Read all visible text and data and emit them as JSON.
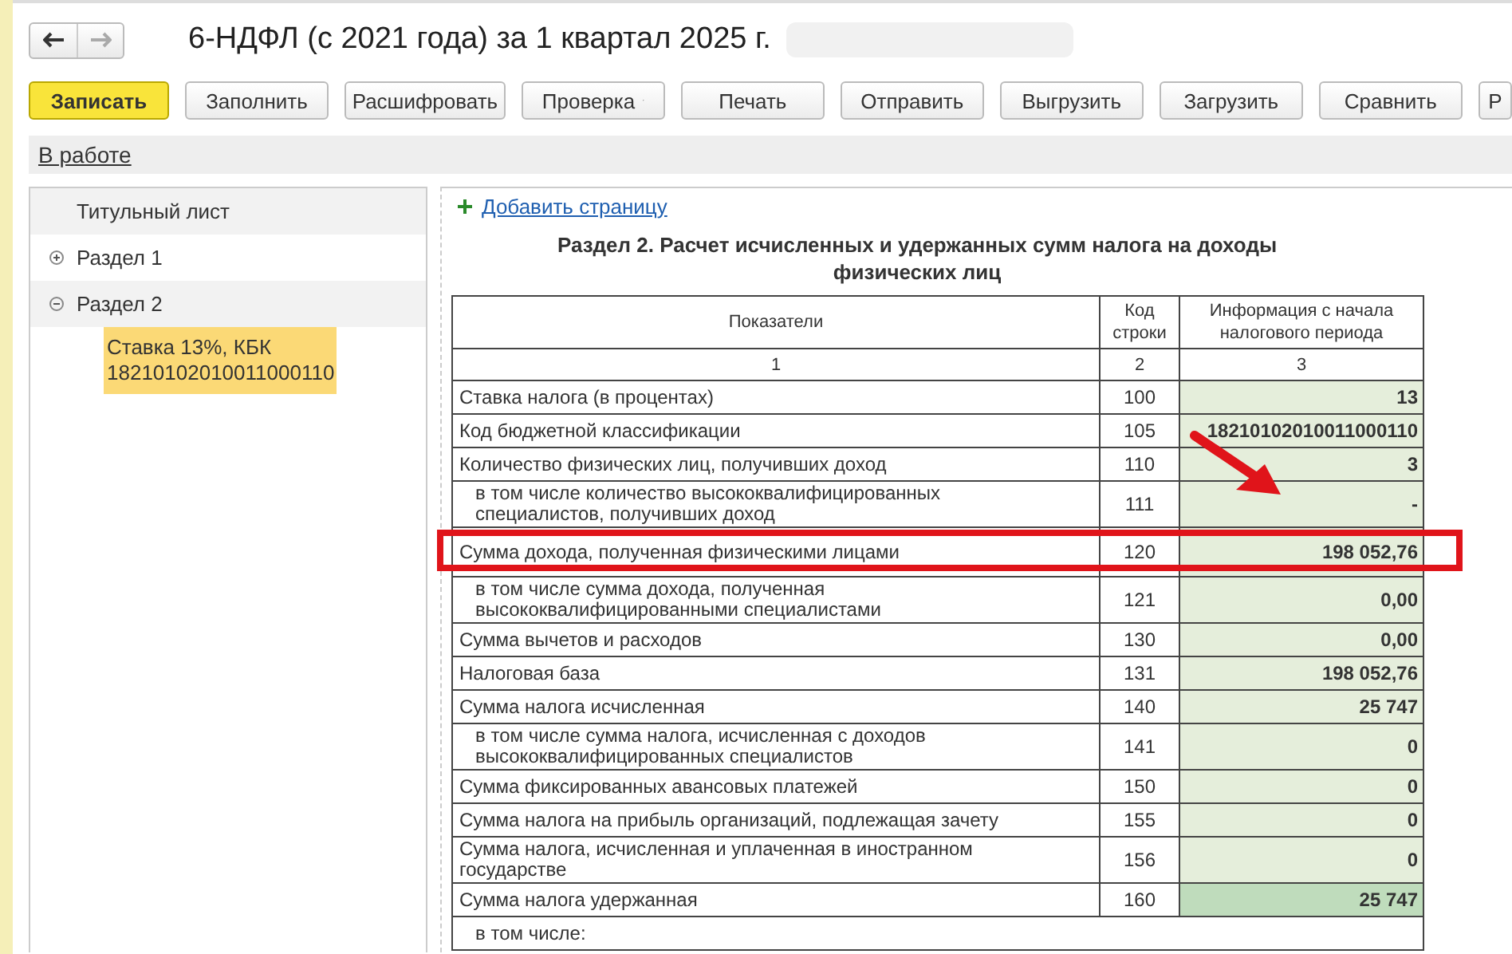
{
  "window": {
    "title": "6-НДФЛ (с 2021 года) за 1 квартал 2025 г."
  },
  "nav": [
    {
      "kind": "back",
      "disabled": false
    },
    {
      "kind": "forward",
      "disabled": true
    }
  ],
  "toolbar": [
    {
      "label": "Записать",
      "kind": "primary"
    },
    {
      "label": "Заполнить",
      "kind": "plain"
    },
    {
      "label": "Расшифровать",
      "kind": "plain"
    },
    {
      "label": "Проверка",
      "kind": "dropdown"
    },
    {
      "label": "Печать",
      "kind": "plain"
    },
    {
      "label": "Отправить",
      "kind": "plain"
    },
    {
      "label": "Выгрузить",
      "kind": "plain"
    },
    {
      "label": "Загрузить",
      "kind": "plain"
    },
    {
      "label": "Сравнить",
      "kind": "plain"
    },
    {
      "label": "Р",
      "kind": "plain"
    }
  ],
  "status_link": "В работе",
  "sidebar": {
    "items": [
      {
        "kind": "page",
        "label": "Титульный лист",
        "selected": false
      },
      {
        "kind": "section",
        "label": "Раздел 1",
        "expanded": false,
        "selected": false
      },
      {
        "kind": "section",
        "label": "Раздел 2",
        "expanded": true,
        "selected": false,
        "children": [
          {
            "label": "Ставка 13%, КБК 18210102010011000110",
            "selected": true
          }
        ]
      }
    ]
  },
  "add_page_link": "Добавить страницу",
  "section_title": "Раздел 2. Расчет исчисленных и удержанных сумм налога на доходы физических лиц",
  "table": {
    "columns": [
      "Показатели",
      "Код строки",
      "Информация с начала налогового периода"
    ],
    "column_numbers": [
      "1",
      "2",
      "3"
    ],
    "rows": [
      {
        "kind": "data",
        "label": "Ставка налога (в процентах)",
        "code": "100",
        "value": "13",
        "selected": false,
        "highlighted": false
      },
      {
        "kind": "data",
        "label": "Код бюджетной классификации",
        "code": "105",
        "value": "18210102010011000110",
        "selected": false,
        "highlighted": false
      },
      {
        "kind": "data",
        "label": "Количество физических лиц, получивших доход",
        "code": "110",
        "value": "3",
        "selected": false,
        "highlighted": false,
        "children": [
          {
            "kind": "data",
            "label": "в том числе количество высококвалифицированных специалистов, получивших доход",
            "code": "111",
            "value": "-",
            "selected": false,
            "highlighted": false
          }
        ]
      },
      {
        "kind": "data",
        "label": "Сумма дохода, полученная физическими лицами",
        "code": "120",
        "value": "198 052,76",
        "selected": false,
        "highlighted": true,
        "children": [
          {
            "kind": "data",
            "label": "в том числе сумма дохода, полученная высококвалифицированными специалистами",
            "code": "121",
            "value": "0,00",
            "selected": false,
            "highlighted": false
          }
        ]
      },
      {
        "kind": "data",
        "label": "Сумма вычетов и расходов",
        "code": "130",
        "value": "0,00",
        "selected": false,
        "highlighted": false
      },
      {
        "kind": "data",
        "label": "Налоговая база",
        "code": "131",
        "value": "198 052,76",
        "selected": false,
        "highlighted": false
      },
      {
        "kind": "data",
        "label": "Сумма налога исчисленная",
        "code": "140",
        "value": "25 747",
        "selected": false,
        "highlighted": false,
        "children": [
          {
            "kind": "data",
            "label": "в том числе сумма налога, исчисленная с доходов высококвалифицированных специалистов",
            "code": "141",
            "value": "0",
            "selected": false,
            "highlighted": false
          }
        ]
      },
      {
        "kind": "data",
        "label": "Сумма фиксированных авансовых платежей",
        "code": "150",
        "value": "0",
        "selected": false,
        "highlighted": false
      },
      {
        "kind": "data",
        "label": "Сумма налога на прибыль организаций, подлежащая зачету",
        "code": "155",
        "value": "0",
        "selected": false,
        "highlighted": false
      },
      {
        "kind": "data",
        "label": "Сумма налога, исчисленная и уплаченная в иностранном государстве",
        "code": "156",
        "value": "0",
        "selected": false,
        "highlighted": false
      },
      {
        "kind": "data",
        "label": "Сумма налога удержанная",
        "code": "160",
        "value": "25 747",
        "selected": true,
        "highlighted": false,
        "children": [
          {
            "kind": "span",
            "label": "в том числе:"
          }
        ]
      }
    ]
  },
  "pointer_arrow": true
}
